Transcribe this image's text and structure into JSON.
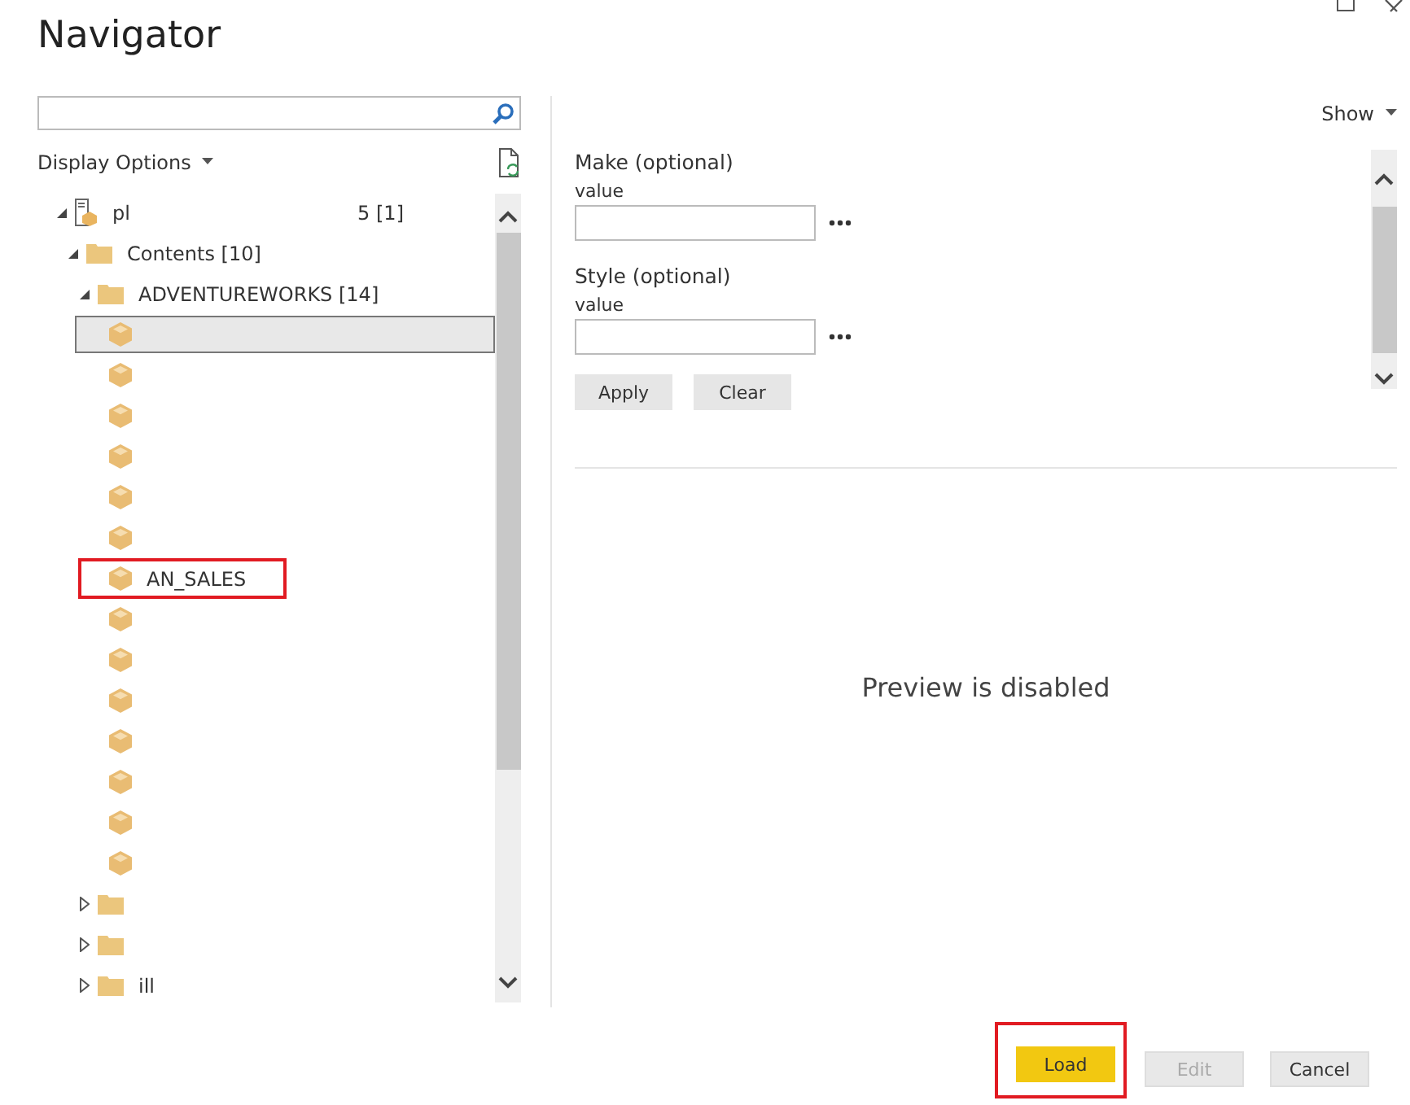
{
  "window": {
    "title": "Navigator"
  },
  "display_options": {
    "label": "Display Options"
  },
  "tree": [
    {
      "label": "pl",
      "count": "5 [1]",
      "kind": "server",
      "expanded": true,
      "selected": false,
      "highlighted": false,
      "children": [
        {
          "label": "Contents [10]",
          "kind": "folder",
          "expanded": true,
          "selected": false,
          "highlighted": false,
          "children": [
            {
              "label": "ADVENTUREWORKS [14]",
              "kind": "folder",
              "expanded": true,
              "selected": false,
              "highlighted": false,
              "children": [
                {
                  "kind": "cube",
                  "selected": true,
                  "highlighted": false
                },
                {
                  "kind": "cube",
                  "selected": false,
                  "highlighted": false
                },
                {
                  "kind": "cube",
                  "selected": false,
                  "highlighted": false
                },
                {
                  "kind": "cube",
                  "selected": false,
                  "highlighted": false
                },
                {
                  "kind": "cube",
                  "selected": false,
                  "highlighted": false
                },
                {
                  "kind": "cube",
                  "selected": false,
                  "highlighted": false
                },
                {
                  "label": "AN_SALES",
                  "kind": "cube",
                  "selected": false,
                  "highlighted": true
                },
                {
                  "kind": "cube",
                  "selected": false,
                  "highlighted": false
                },
                {
                  "kind": "cube",
                  "selected": false,
                  "highlighted": false
                },
                {
                  "kind": "cube",
                  "selected": false,
                  "highlighted": false
                },
                {
                  "kind": "cube",
                  "selected": false,
                  "highlighted": false
                },
                {
                  "kind": "cube",
                  "selected": false,
                  "highlighted": false
                },
                {
                  "kind": "cube",
                  "selected": false,
                  "highlighted": false
                },
                {
                  "kind": "cube",
                  "selected": false,
                  "highlighted": false
                }
              ]
            },
            {
              "kind": "folder",
              "expanded": false,
              "selected": false,
              "highlighted": false
            },
            {
              "kind": "folder",
              "expanded": false,
              "selected": false,
              "highlighted": false
            },
            {
              "label": "ill",
              "kind": "folder",
              "expanded": false,
              "selected": false,
              "highlighted": false
            }
          ]
        }
      ]
    }
  ],
  "show_menu": {
    "label": "Show"
  },
  "parameters": [
    {
      "label": "Make (optional)",
      "sublabel": "value"
    },
    {
      "label": "Style (optional)",
      "sublabel": "value"
    }
  ],
  "parameter_buttons": [
    "Apply",
    "Clear"
  ],
  "preview": {
    "message": "Preview is disabled"
  },
  "footer_buttons": [
    {
      "label": "Load",
      "kind": "primary",
      "disabled": false,
      "highlighted": true
    },
    {
      "label": "Edit",
      "kind": "normal",
      "disabled": true,
      "highlighted": false
    },
    {
      "label": "Cancel",
      "kind": "normal",
      "disabled": false,
      "highlighted": false
    }
  ]
}
